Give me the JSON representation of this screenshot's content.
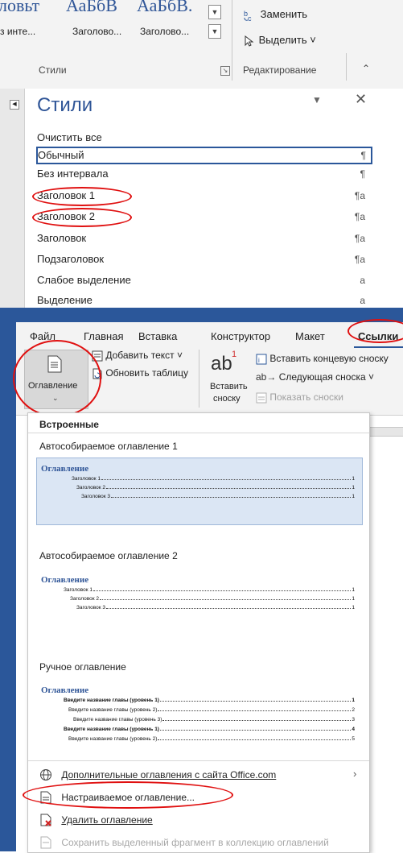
{
  "ribbon_top": {
    "gallery_samples": [
      "ловьт",
      "АаБбВ",
      "АаБбВ."
    ],
    "gallery_labels": [
      "з инте...",
      "Заголово...",
      "Заголово..."
    ],
    "styles_group_label": "Стили",
    "replace_label": "Заменить",
    "select_label": "Выделить ˅",
    "editing_group_label": "Редактирование"
  },
  "styles_pane": {
    "title": "Стили",
    "items": [
      {
        "label": "Очистить все",
        "mark": ""
      },
      {
        "label": "Обычный",
        "mark": "¶"
      },
      {
        "label": "Без интервала",
        "mark": "¶"
      },
      {
        "label": "Заголовок 1",
        "mark": "¶a"
      },
      {
        "label": "Заголовок 2",
        "mark": "¶a"
      },
      {
        "label": "Заголовок",
        "mark": "¶a"
      },
      {
        "label": "Подзаголовок",
        "mark": "¶a"
      },
      {
        "label": "Слабое выделение",
        "mark": "a"
      },
      {
        "label": "Выделение",
        "mark": "a"
      }
    ]
  },
  "tabs": [
    "Файл",
    "Главная",
    "Вставка",
    "Конструктор",
    "Макет",
    "Ссылки"
  ],
  "ribbon_bottom": {
    "toc_button": "Оглавление",
    "add_text": "Добавить текст ˅",
    "update_table": "Обновить таблицу",
    "insert_footnote_line1": "Вставить",
    "insert_footnote_line2": "сноску",
    "insert_endnote": "Вставить концевую сноску",
    "next_footnote": "Следующая сноска ˅",
    "show_notes": "Показать сноски",
    "footnote_glyph": "ab",
    "footnote_sup": "1"
  },
  "dropdown": {
    "builtin_header": "Встроенные",
    "auto1_title": "Автособираемое оглавление 1",
    "auto2_title": "Автособираемое оглавление 2",
    "manual_title": "Ручное оглавление",
    "toc_heading": "Оглавление",
    "auto_entries": [
      {
        "text": "Заголовок 1",
        "page": "1"
      },
      {
        "text": "Заголовок 2",
        "page": "1"
      },
      {
        "text": "Заголовок 3",
        "page": "1"
      }
    ],
    "manual_entries": [
      {
        "text": "Введите название главы (уровень 1)",
        "page": "1"
      },
      {
        "text": "Введите название главы (уровень 2)",
        "page": "2"
      },
      {
        "text": "Введите название главы (уровень 3)",
        "page": "3"
      },
      {
        "text": "Введите название главы (уровень 1)",
        "page": "4"
      },
      {
        "text": "Введите название главы (уровень 2)",
        "page": "5"
      }
    ],
    "more_online": "Дополнительные оглавления с сайта Office.com",
    "custom_toc": "Настраиваемое оглавление...",
    "remove_toc": "Удалить оглавление",
    "save_selection": "Сохранить выделенный фрагмент в коллекцию оглавлений"
  }
}
